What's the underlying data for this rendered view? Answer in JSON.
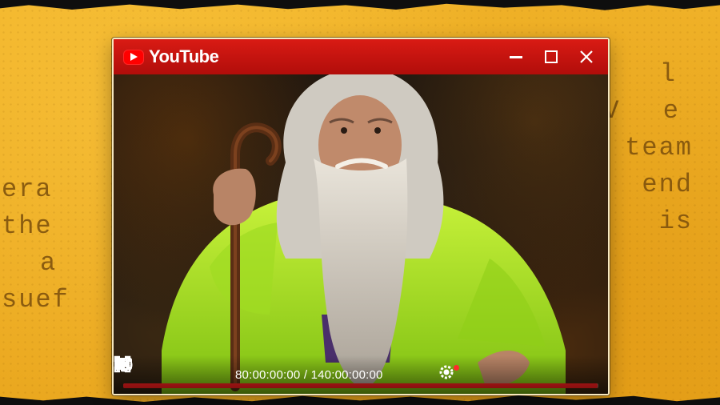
{
  "background": {
    "left_words": [
      "era",
      "the",
      "a",
      "suef"
    ],
    "right_words": [
      "S l",
      "V e",
      "team",
      "end",
      "is"
    ]
  },
  "window": {
    "app_name": "YouTube",
    "controls": {
      "minimize": "minimize-icon",
      "maximize": "maximize-icon",
      "close": "close-icon"
    }
  },
  "player": {
    "time_current": "80:00:00:00",
    "time_total": "140:00:00:00",
    "progress_fraction": 0.999,
    "icons": [
      "play-icon",
      "skip-icon",
      "volume-icon",
      "settings-icon",
      "gear-icon",
      "theater-icon",
      "fullscreen-icon"
    ],
    "colors": {
      "accent": "#ff1e1e",
      "titlebar": "#c8140f",
      "jacket": "#a6e61c"
    }
  }
}
